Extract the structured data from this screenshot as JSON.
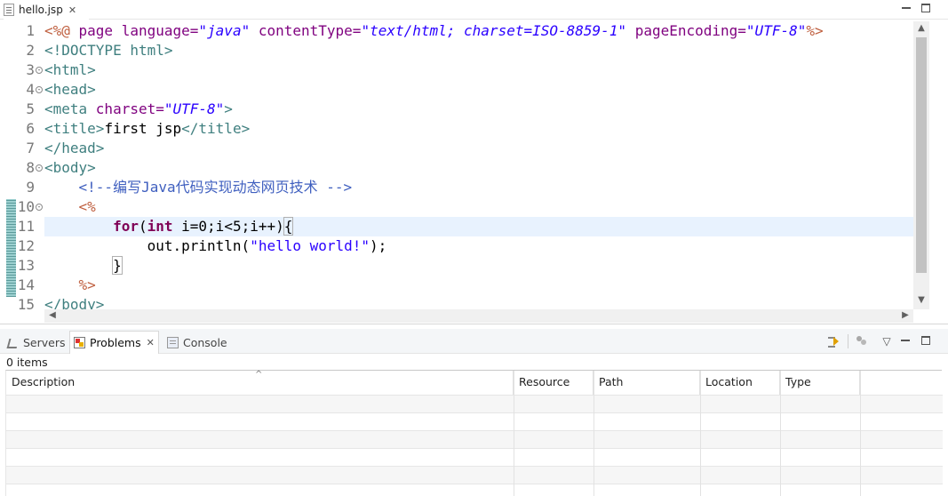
{
  "editor": {
    "tab": {
      "label": "hello.jsp",
      "close": "✕"
    },
    "window": {
      "minimize": "",
      "maximize": ""
    },
    "line_numbers": [
      "1",
      "2",
      "3",
      "4",
      "5",
      "6",
      "7",
      "8",
      "9",
      "10",
      "11",
      "12",
      "13",
      "14",
      "15"
    ],
    "fold_markers": [
      "3",
      "4",
      "8",
      "10"
    ],
    "current_line": 11,
    "lines": [
      {
        "segments": [
          {
            "text": "<%@ ",
            "cls": "jsp"
          },
          {
            "text": "page ",
            "cls": "attr"
          },
          {
            "text": "language=",
            "cls": "attr"
          },
          {
            "text": "\"java\"",
            "cls": "val"
          },
          {
            "text": " contentType=",
            "cls": "attr"
          },
          {
            "text": "\"text/html; charset=ISO-8859-1\"",
            "cls": "val"
          },
          {
            "text": " pageEncoding=",
            "cls": "attr"
          },
          {
            "text": "\"UTF-8\"",
            "cls": "val"
          },
          {
            "text": "%>",
            "cls": "jsp"
          }
        ]
      },
      {
        "segments": [
          {
            "text": "<!DOCTYPE html>",
            "cls": "tag"
          }
        ]
      },
      {
        "segments": [
          {
            "text": "<html>",
            "cls": "tag"
          }
        ]
      },
      {
        "segments": [
          {
            "text": "<head>",
            "cls": "tag"
          }
        ]
      },
      {
        "segments": [
          {
            "text": "<meta ",
            "cls": "tag"
          },
          {
            "text": "charset=",
            "cls": "attr"
          },
          {
            "text": "\"UTF-8\"",
            "cls": "val"
          },
          {
            "text": ">",
            "cls": "tag"
          }
        ]
      },
      {
        "segments": [
          {
            "text": "<title>",
            "cls": "tag"
          },
          {
            "text": "first jsp",
            "cls": "plain"
          },
          {
            "text": "</title>",
            "cls": "tag"
          }
        ]
      },
      {
        "segments": [
          {
            "text": "</head>",
            "cls": "tag"
          }
        ]
      },
      {
        "segments": [
          {
            "text": "<body>",
            "cls": "tag"
          }
        ]
      },
      {
        "segments": [
          {
            "text": "    <!--编写Java代码实现动态网页技术 -->",
            "cls": "cmt"
          }
        ]
      },
      {
        "segments": [
          {
            "text": "    <%",
            "cls": "jsp"
          }
        ]
      },
      {
        "segments": [
          {
            "text": "        ",
            "cls": "plain"
          },
          {
            "text": "for",
            "cls": "kw"
          },
          {
            "text": "(",
            "cls": "plain"
          },
          {
            "text": "int",
            "cls": "kw"
          },
          {
            "text": " i=0;i<5;i++)",
            "cls": "plain"
          },
          {
            "text": "{",
            "cls": "brace"
          }
        ]
      },
      {
        "segments": [
          {
            "text": "            out.println(",
            "cls": "plain"
          },
          {
            "text": "\"hello world!\"",
            "cls": "str"
          },
          {
            "text": ");",
            "cls": "plain"
          }
        ]
      },
      {
        "segments": [
          {
            "text": "        ",
            "cls": "plain"
          },
          {
            "text": "}",
            "cls": "brace"
          }
        ]
      },
      {
        "segments": [
          {
            "text": "    %>",
            "cls": "jsp"
          }
        ]
      },
      {
        "segments": [
          {
            "text": "</body>",
            "cls": "tag"
          }
        ]
      }
    ],
    "colors": {
      "jsp": "#bf5f3f",
      "tag": "#3f7f7f",
      "attr": "#7f007f",
      "val": "#2a00ff",
      "cmt": "#3f5fbf",
      "kw": "#7f0055",
      "current_line": "#e8f2fe"
    }
  },
  "problems_view": {
    "tabs": [
      {
        "label": "Servers",
        "icon": "servers-icon"
      },
      {
        "label": "Problems",
        "icon": "problems-icon",
        "close": "✕"
      },
      {
        "label": "Console",
        "icon": "console-icon"
      }
    ],
    "items_count": "0 items",
    "columns": [
      "Description",
      "Resource",
      "Path",
      "Location",
      "Type"
    ],
    "toolbar": [
      "filter-icon",
      "config-icon",
      "view-menu-icon",
      "minimize-icon",
      "maximize-icon"
    ]
  }
}
